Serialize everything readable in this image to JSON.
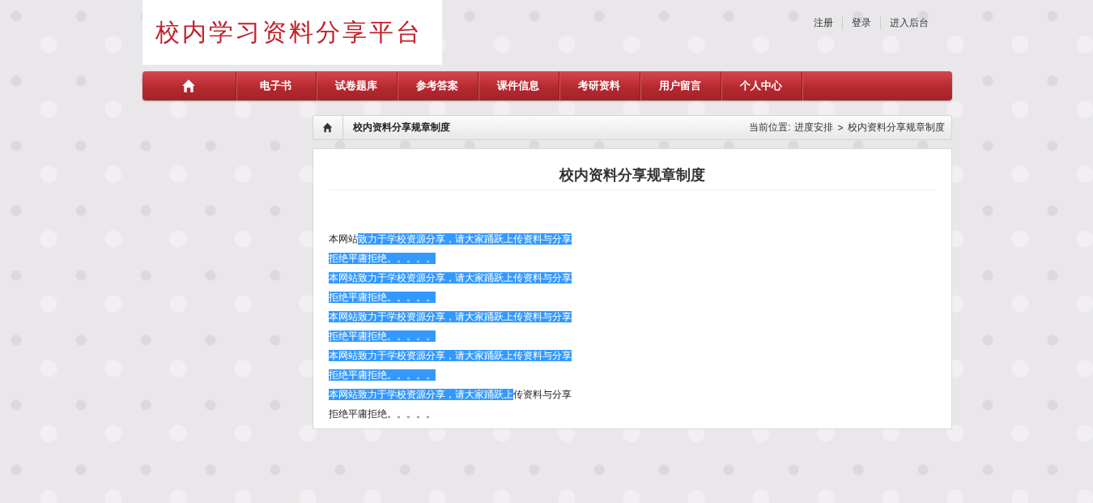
{
  "header": {
    "logo": "校内学习资料分享平台",
    "links": [
      "注册",
      "登录",
      "进入后台"
    ]
  },
  "nav": {
    "items": [
      {
        "kind": "home",
        "selected": false
      },
      {
        "kind": "text",
        "label": "电子书",
        "selected": false
      },
      {
        "kind": "text",
        "label": "试卷题库",
        "selected": false
      },
      {
        "kind": "text",
        "label": "参考答案",
        "selected": false
      },
      {
        "kind": "text",
        "label": "课件信息",
        "selected": false
      },
      {
        "kind": "text",
        "label": "考研资料",
        "selected": false
      },
      {
        "kind": "text",
        "label": "用户留言",
        "selected": false
      },
      {
        "kind": "text",
        "label": "个人中心",
        "selected": false
      }
    ]
  },
  "breadcrumb": {
    "title": "校内资料分享规章制度",
    "location_label": "当前位置:",
    "path": [
      "进度安排",
      "校内资料分享规章制度"
    ],
    "separator": ">"
  },
  "article": {
    "title": "校内资料分享规章制度",
    "lines": [
      [
        {
          "text": "本网站",
          "selected": false
        },
        {
          "text": "致力于学校资源分享，请大家踊跃上传资料与分享",
          "selected": true
        }
      ],
      [
        {
          "text": "拒绝平庸拒绝。。。。。",
          "selected": true
        }
      ],
      [
        {
          "text": "本网站致力于学校资源分享，请大家踊跃上传资料与分享",
          "selected": true
        }
      ],
      [
        {
          "text": "拒绝平庸拒绝。。。。。",
          "selected": true
        }
      ],
      [
        {
          "text": "本网站致力于学校资源分享，请大家踊跃上传资料与分享",
          "selected": true
        }
      ],
      [
        {
          "text": "拒绝平庸拒绝。。。。。",
          "selected": true
        }
      ],
      [
        {
          "text": "本网站致力于学校资源分享，请大家踊跃上传资料与分享",
          "selected": true
        }
      ],
      [
        {
          "text": "拒绝平庸拒绝。。。。。",
          "selected": true
        }
      ],
      [
        {
          "text": "本网站致力于学校资源分享，请大家踊跃上",
          "selected": true
        },
        {
          "text": "传资料与分享",
          "selected": false
        }
      ],
      [
        {
          "text": "拒绝平庸拒绝。。。。。",
          "selected": false
        }
      ]
    ]
  }
}
